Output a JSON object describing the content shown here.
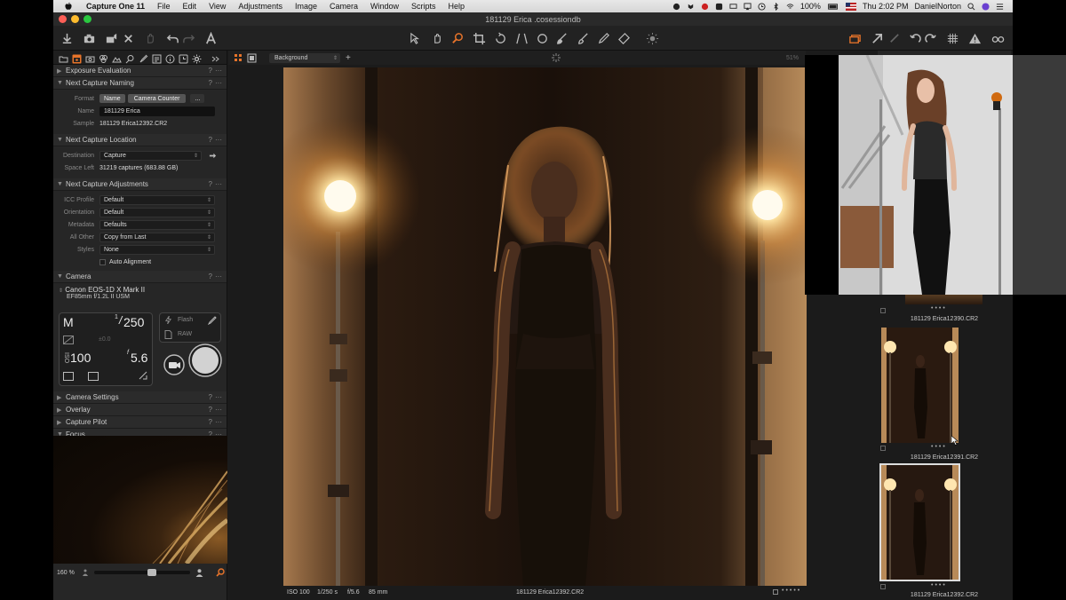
{
  "menubar": {
    "app_name": "Capture One 11",
    "menus": [
      "File",
      "Edit",
      "View",
      "Adjustments",
      "Image",
      "Camera",
      "Window",
      "Scripts",
      "Help"
    ],
    "battery": "100%",
    "clock": "Thu 2:02 PM",
    "user": "DanielNorton"
  },
  "window": {
    "title": "181129 Erica .cosessiondb"
  },
  "panel": {
    "sections": {
      "exposure_evaluation": "Exposure Evaluation",
      "next_capture_naming": "Next Capture Naming",
      "next_capture_location": "Next Capture Location",
      "next_capture_adjustments": "Next Capture Adjustments",
      "camera": "Camera",
      "camera_settings": "Camera Settings",
      "overlay": "Overlay",
      "capture_pilot": "Capture Pilot",
      "focus": "Focus"
    },
    "help_mark": "?",
    "more_mark": "···",
    "naming": {
      "format_label": "Format",
      "format_tokens": [
        "Name",
        "Camera Counter"
      ],
      "format_more": "...",
      "name_label": "Name",
      "name_value": "181129 Erica",
      "sample_label": "Sample",
      "sample_value": "181129 Erica12392.CR2"
    },
    "location": {
      "destination_label": "Destination",
      "destination_value": "Capture",
      "space_label": "Space Left",
      "space_value": "31219 captures (683.88 GB)"
    },
    "adjustments": {
      "icc_label": "ICC Profile",
      "icc_value": "Default",
      "orientation_label": "Orientation",
      "orientation_value": "Default",
      "metadata_label": "Metadata",
      "metadata_value": "Defaults",
      "allother_label": "All Other",
      "allother_value": "Copy from Last",
      "styles_label": "Styles",
      "styles_value": "None",
      "auto_alignment": "Auto Alignment"
    },
    "camera": {
      "model": "Canon EOS-1D X Mark II",
      "lens": "EF85mm f/1.2L II USM",
      "mode": "M",
      "shutter": "250",
      "exposure_comp": "±0.0",
      "iso": "100",
      "aperture": "5.6",
      "flash_label": "Flash",
      "raw_label": "RAW"
    },
    "zoom": "160 %"
  },
  "viewer": {
    "background_select": "Background",
    "zoom_pct": "51%",
    "info": {
      "iso": "ISO 100",
      "shutter": "1/250 s",
      "aperture": "f/5.6",
      "focal": "85 mm",
      "filename": "181129 Erica12392.CR2"
    }
  },
  "browser": {
    "thumbs": [
      {
        "caption": "181129 Erica12390.CR2"
      },
      {
        "caption": "181129 Erica12391.CR2"
      },
      {
        "caption": "181129 Erica12392.CR2"
      }
    ]
  },
  "colors": {
    "accent": "#e8742a",
    "panel": "#262626",
    "viewer": "#1b1b1b"
  }
}
